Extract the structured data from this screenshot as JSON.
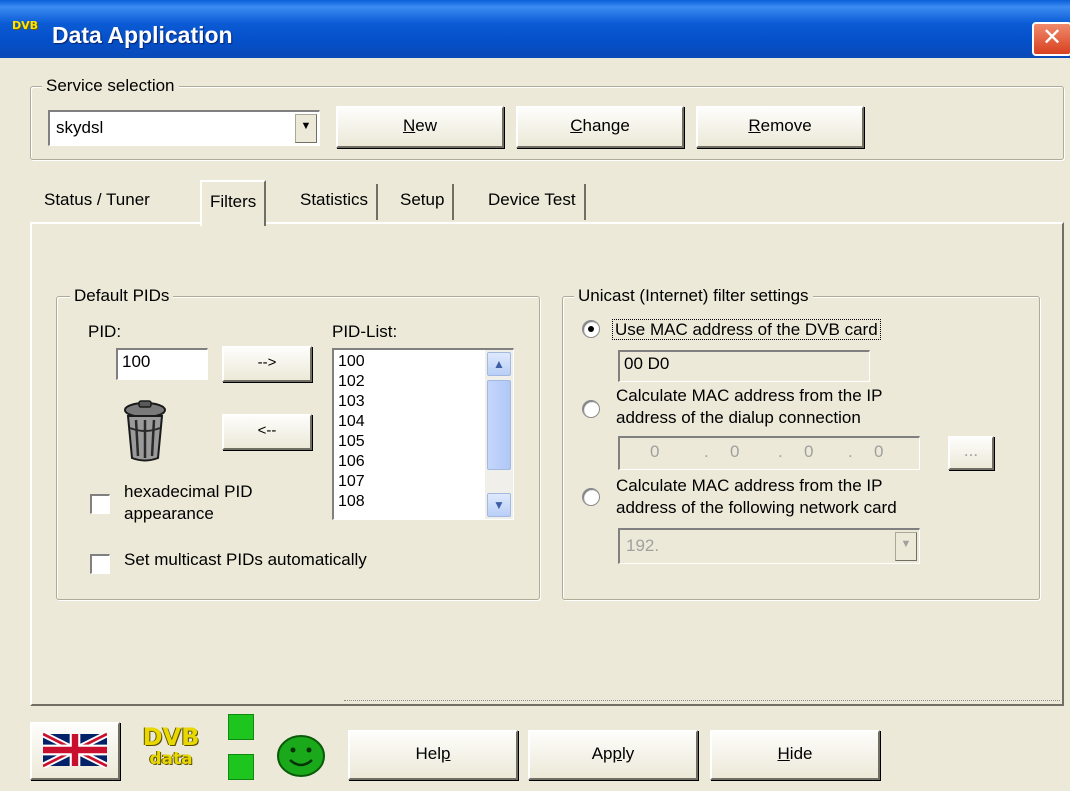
{
  "window": {
    "title": "Data Application",
    "icon_name": "dvb-app-icon",
    "icon_text": "DVB",
    "close_glyph": "✕"
  },
  "service_selection": {
    "legend": "Service selection",
    "selected": "skydsl",
    "buttons": {
      "new": {
        "prefix": "",
        "accel": "N",
        "rest": "ew"
      },
      "change": {
        "prefix": "",
        "accel": "C",
        "rest": "hange"
      },
      "remove": {
        "prefix": "",
        "accel": "R",
        "rest": "emove"
      }
    }
  },
  "tabs": [
    {
      "label": "Status / Tuner",
      "active": false
    },
    {
      "label": "Filters",
      "active": true
    },
    {
      "label": "Statistics",
      "active": false
    },
    {
      "label": "Setup",
      "active": false
    },
    {
      "label": "Device Test",
      "active": false
    }
  ],
  "default_pids": {
    "legend": "Default PIDs",
    "pid_label": "PID:",
    "pid_value": "100",
    "add_button": "-->",
    "remove_button": "<--",
    "list_label": "PID-List:",
    "list_items": [
      "100",
      "102",
      "103",
      "104",
      "105",
      "106",
      "107",
      "108"
    ],
    "hex_checkbox": {
      "line1": "hexadecimal PID",
      "line2": "appearance",
      "checked": false
    },
    "multicast_checkbox": {
      "label": "Set multicast PIDs automatically",
      "checked": false
    }
  },
  "unicast": {
    "legend": "Unicast (Internet) filter settings",
    "option1": {
      "label": "Use MAC address of the DVB card",
      "selected": true,
      "mac_value": "00 D0"
    },
    "option2": {
      "line1": "Calculate MAC address from the IP",
      "line2": "address of the dialup connection",
      "selected": false,
      "ip": [
        "0",
        "0",
        "0",
        "0"
      ],
      "browse_label": "..."
    },
    "option3": {
      "line1": "Calculate MAC address from the IP",
      "line2": "address of the following network card",
      "selected": false,
      "card_value": "192."
    }
  },
  "footer": {
    "status_colors": {
      "led": "#1ec51e",
      "smiley": "#1aa91a"
    },
    "dvb_logo_top": "DVB",
    "dvb_logo_bottom": "data",
    "buttons": {
      "help": {
        "prefix": "Hel",
        "accel": "p",
        "rest": ""
      },
      "apply": {
        "prefix": "Ap",
        "accel": "p",
        "rest": "ly"
      },
      "hide": {
        "prefix": "",
        "accel": "H",
        "rest": "ide"
      }
    }
  }
}
